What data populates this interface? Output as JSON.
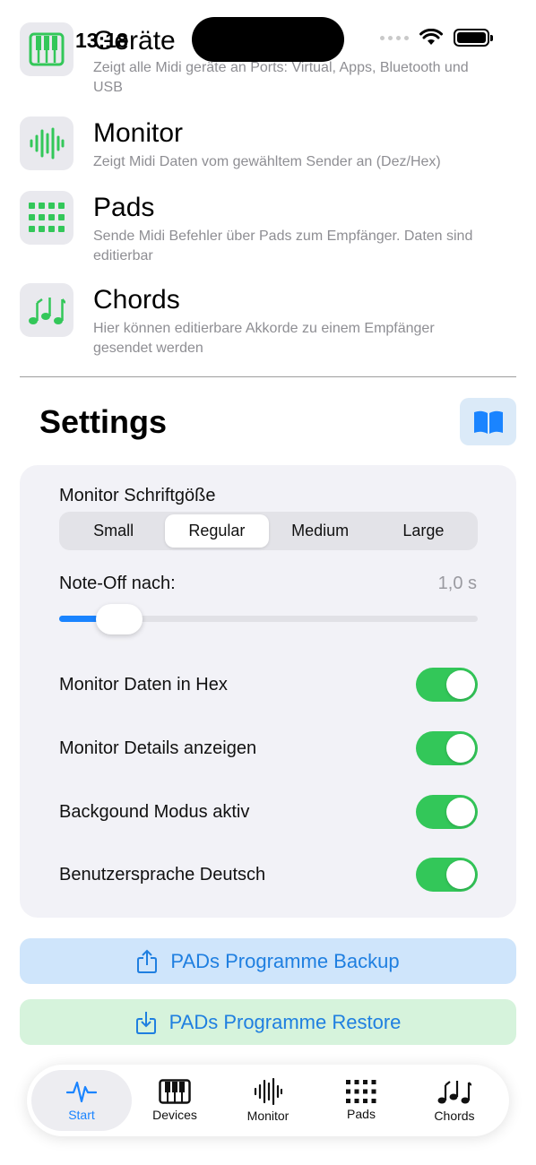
{
  "status": {
    "time": "13:18"
  },
  "features": [
    {
      "title": "Geräte",
      "desc": "Zeigt alle Midi geräte an Ports: Virtual, Apps, Bluetooth und USB",
      "icon": "piano-icon"
    },
    {
      "title": "Monitor",
      "desc": "Zeigt Midi Daten vom gewähltem Sender an (Dez/Hex)",
      "icon": "waveform-icon"
    },
    {
      "title": "Pads",
      "desc": "Sende Midi Befehler über Pads zum Empfänger. Daten sind editierbar",
      "icon": "grid-icon"
    },
    {
      "title": "Chords",
      "desc": "Hier können editierbare Akkorde zu einem Empfänger gesendet werden",
      "icon": "notes-icon"
    }
  ],
  "settings": {
    "title": "Settings",
    "font_size_label": "Monitor Schriftgöße",
    "segments": [
      "Small",
      "Regular",
      "Medium",
      "Large"
    ],
    "selected_segment": "Regular",
    "note_off_label": "Note-Off nach:",
    "note_off_value": "1,0 s",
    "note_off_level": 0.13,
    "toggles": [
      {
        "label": "Monitor Daten in Hex",
        "on": true
      },
      {
        "label": "Monitor Details anzeigen",
        "on": true
      },
      {
        "label": "Backgound Modus aktiv",
        "on": true
      },
      {
        "label": "Benutzersprache Deutsch",
        "on": true
      }
    ]
  },
  "actions": {
    "backup_label": "PADs Programme Backup",
    "restore_label": "PADs Programme Restore"
  },
  "tabs": [
    {
      "label": "Start",
      "icon": "waveform-pulse-icon",
      "active": true
    },
    {
      "label": "Devices",
      "icon": "piano-icon",
      "active": false
    },
    {
      "label": "Monitor",
      "icon": "waveform-icon",
      "active": false
    },
    {
      "label": "Pads",
      "icon": "grid-icon",
      "active": false
    },
    {
      "label": "Chords",
      "icon": "notes-icon",
      "active": false
    }
  ],
  "colors": {
    "accent": "#1a84ff",
    "toggle_on": "#33c759",
    "feature_icon": "#33c759"
  }
}
